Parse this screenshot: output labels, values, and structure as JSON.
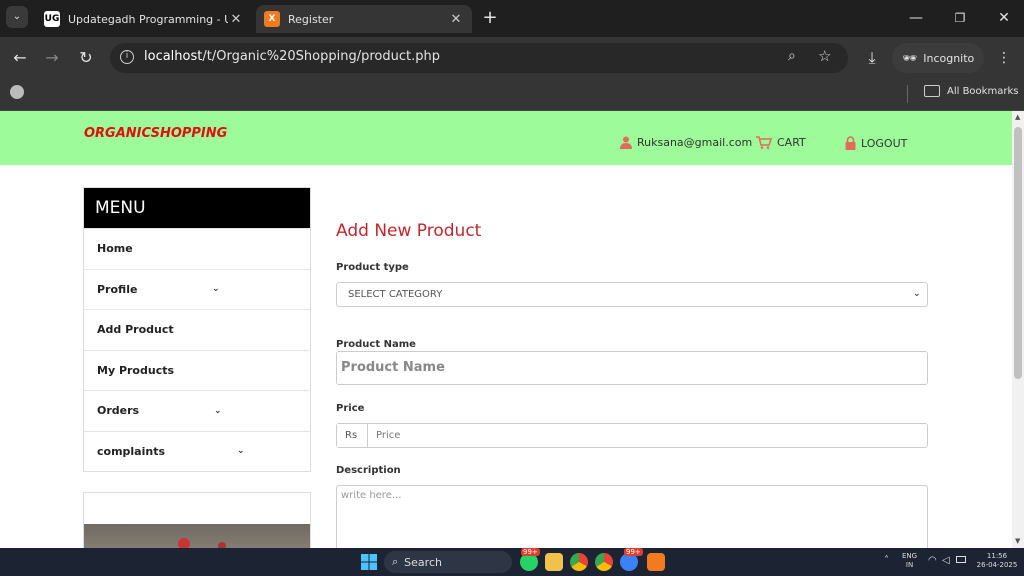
{
  "browser": {
    "tabs": [
      {
        "title": "Updategadh Programming - Upda",
        "favicon": "UG"
      },
      {
        "title": "Register",
        "favicon": "X"
      }
    ],
    "url_host": "localhost",
    "url_path": "/t/Organic%20Shopping/product.php",
    "incognito_label": "Incognito",
    "bookmarks_label": "All Bookmarks"
  },
  "site": {
    "logo": "ORGANICSHOPPING",
    "user_email": "Ruksana@gmail.com",
    "cart_label": "CART",
    "logout_label": "LOGOUT",
    "accent": "#c0282d",
    "header_bg": "#9dfb9a"
  },
  "sidebar": {
    "title": "MENU",
    "items": [
      {
        "label": "Home",
        "has_dropdown": false
      },
      {
        "label": "Profile",
        "has_dropdown": true
      },
      {
        "label": "Add Product",
        "has_dropdown": false
      },
      {
        "label": "My Products",
        "has_dropdown": false
      },
      {
        "label": "Orders",
        "has_dropdown": true
      },
      {
        "label": "complaints",
        "has_dropdown": true
      }
    ]
  },
  "form": {
    "title": "Add New Product",
    "product_type_label": "Product type",
    "product_type_value": "SELECT CATEGORY",
    "product_name_label": "Product Name",
    "product_name_placeholder": "Product Name",
    "price_label": "Price",
    "price_addon": "Rs",
    "price_placeholder": "Price",
    "description_label": "Description",
    "description_placeholder": "write here..."
  },
  "taskbar": {
    "search_label": "Search",
    "badge_1": "99+",
    "badge_2": "99+",
    "lang_1": "ENG",
    "lang_2": "IN",
    "time": "11:56",
    "date": "26-04-2025"
  }
}
